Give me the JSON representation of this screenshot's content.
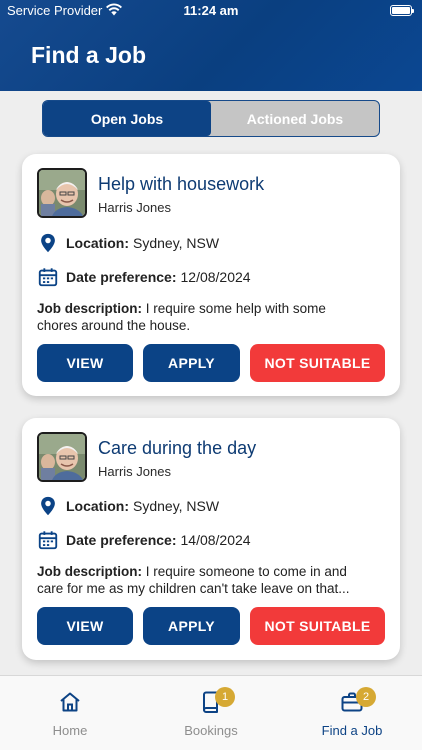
{
  "status_bar": {
    "carrier": "Service Provider",
    "time": "11:24 am"
  },
  "header": {
    "title": "Find a Job"
  },
  "segment": {
    "tabs": [
      {
        "label": "Open Jobs",
        "active": true
      },
      {
        "label": "Actioned Jobs",
        "active": false
      }
    ]
  },
  "jobs": [
    {
      "title": "Help with housework",
      "poster": "Harris Jones",
      "location_label": "Location:",
      "location": "Sydney, NSW",
      "date_label": "Date preference:",
      "date": "12/08/2024",
      "desc_label": "Job description:",
      "desc_line1": "I require some help with some",
      "desc_line2": "chores around the house."
    },
    {
      "title": "Care during the day",
      "poster": "Harris Jones",
      "location_label": "Location:",
      "location": "Sydney, NSW",
      "date_label": "Date preference:",
      "date": "14/08/2024",
      "desc_label": "Job description:",
      "desc_line1": "I require someone to come in and",
      "desc_line2": "care for me as my children can't take leave on that..."
    }
  ],
  "actions": {
    "view": "VIEW",
    "apply": "APPLY",
    "not_suitable": "NOT SUITABLE"
  },
  "tabbar": {
    "items": [
      {
        "label": "Home",
        "icon": "home-icon",
        "badge": ""
      },
      {
        "label": "Bookings",
        "icon": "book-icon",
        "badge": "1"
      },
      {
        "label": "Find a Job",
        "icon": "briefcase-icon",
        "badge": "2"
      }
    ]
  },
  "colors": {
    "primary": "#0b4386",
    "danger": "#f23a3a",
    "badge": "#d6a934",
    "segment_inactive": "#c5c5c5"
  }
}
